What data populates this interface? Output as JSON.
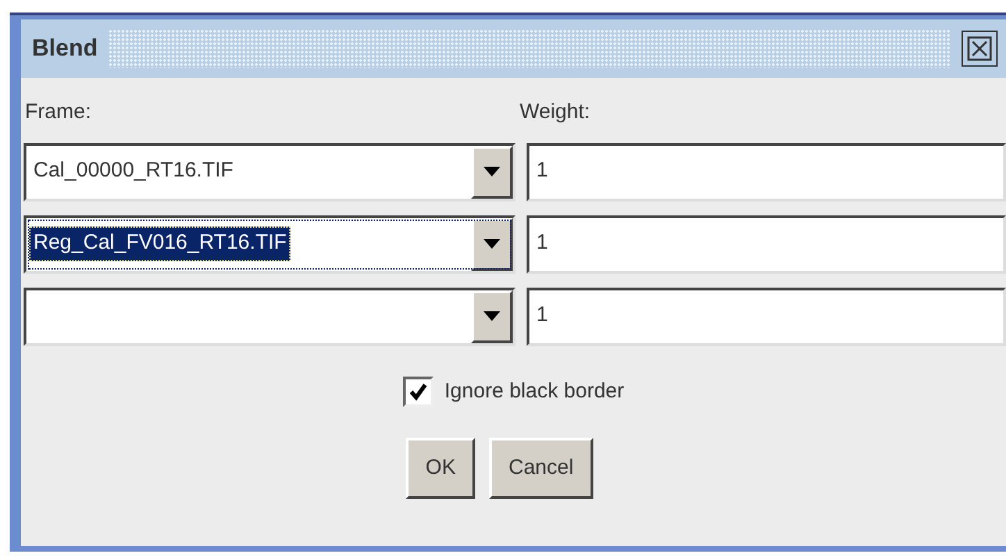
{
  "window": {
    "title": "Blend"
  },
  "headers": {
    "frame": "Frame:",
    "weight": "Weight:"
  },
  "rows": [
    {
      "frame": "Cal_00000_RT16.TIF",
      "weight": "1",
      "selected": false
    },
    {
      "frame": "Reg_Cal_FV016_RT16.TIF",
      "weight": "1",
      "selected": true
    },
    {
      "frame": "",
      "weight": "1",
      "selected": false
    }
  ],
  "checkbox": {
    "label": "Ignore black border",
    "checked": true
  },
  "buttons": [
    "OK",
    "Cancel"
  ]
}
